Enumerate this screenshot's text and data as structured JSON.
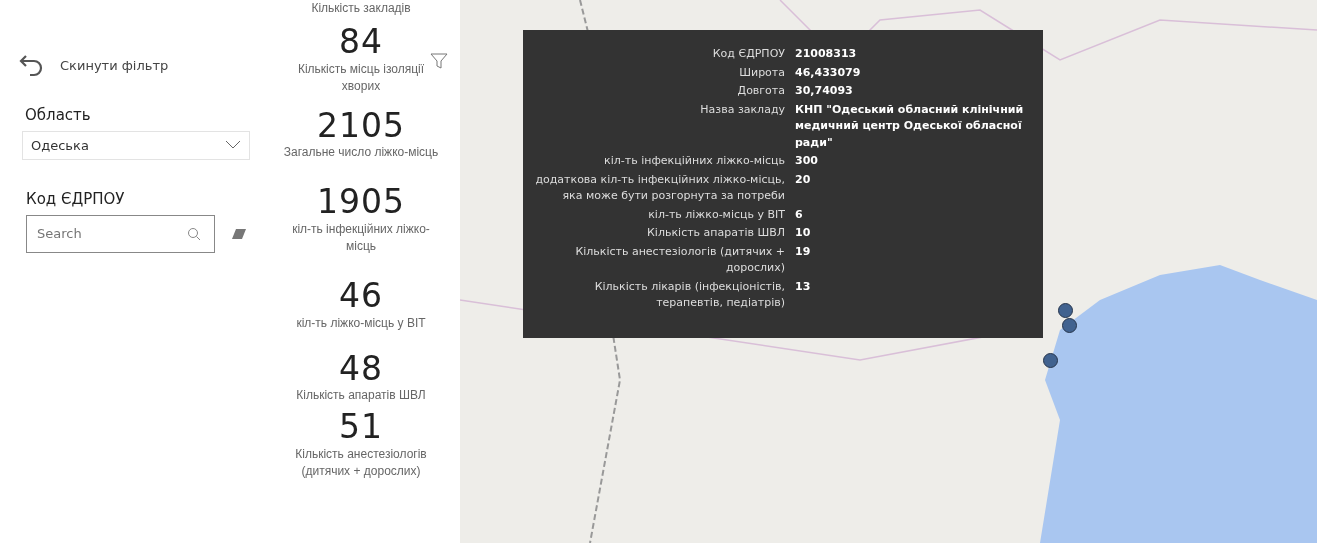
{
  "filter_panel": {
    "reset_label": "Скинути фільтр",
    "region": {
      "label": "Область",
      "value": "Одеська"
    },
    "edrpou": {
      "label": "Код ЄДРПОУ",
      "placeholder": "Search"
    }
  },
  "kpi_header": "Кількість закладів",
  "kpis": [
    {
      "value": "84",
      "label": "Кількість місць ізоляції хворих"
    },
    {
      "value": "2105",
      "label": "Загальне число ліжко-місць"
    },
    {
      "value": "1905",
      "label": "кіл-ть інфекційних ліжко-місць"
    },
    {
      "value": "46",
      "label": "кіл-ть ліжко-місць у ВІТ"
    },
    {
      "value": "48",
      "label": "Кількість апаратів ШВЛ"
    },
    {
      "value": "51",
      "label": "Кількість анестезіологів (дитячих + дорослих)"
    }
  ],
  "map_tooltip": [
    {
      "label": "Код ЄДРПОУ",
      "value": "21008313"
    },
    {
      "label": "Широта",
      "value": "46,433079"
    },
    {
      "label": "Довгота",
      "value": "30,74093"
    },
    {
      "label": "Назва закладу",
      "value": "КНП \"Одеський обласний клінічний медичний центр Одеської обласної ради\""
    },
    {
      "label": "кіл-ть інфекційних ліжко-місць",
      "value": "300"
    },
    {
      "label": "додаткова кіл-ть інфекційних ліжко-місць, яка може бути розгорнута за потреби",
      "value": "20"
    },
    {
      "label": "кіл-ть ліжко-місць у ВІТ",
      "value": "6"
    },
    {
      "label": "Кількість апаратів ШВЛ",
      "value": "10"
    },
    {
      "label": "Кількість анестезіологів (дитячих + дорослих)",
      "value": "19"
    },
    {
      "label": "Кількість лікарів (інфекціоністів, терапевтів, педіатрів)",
      "value": "13"
    }
  ]
}
